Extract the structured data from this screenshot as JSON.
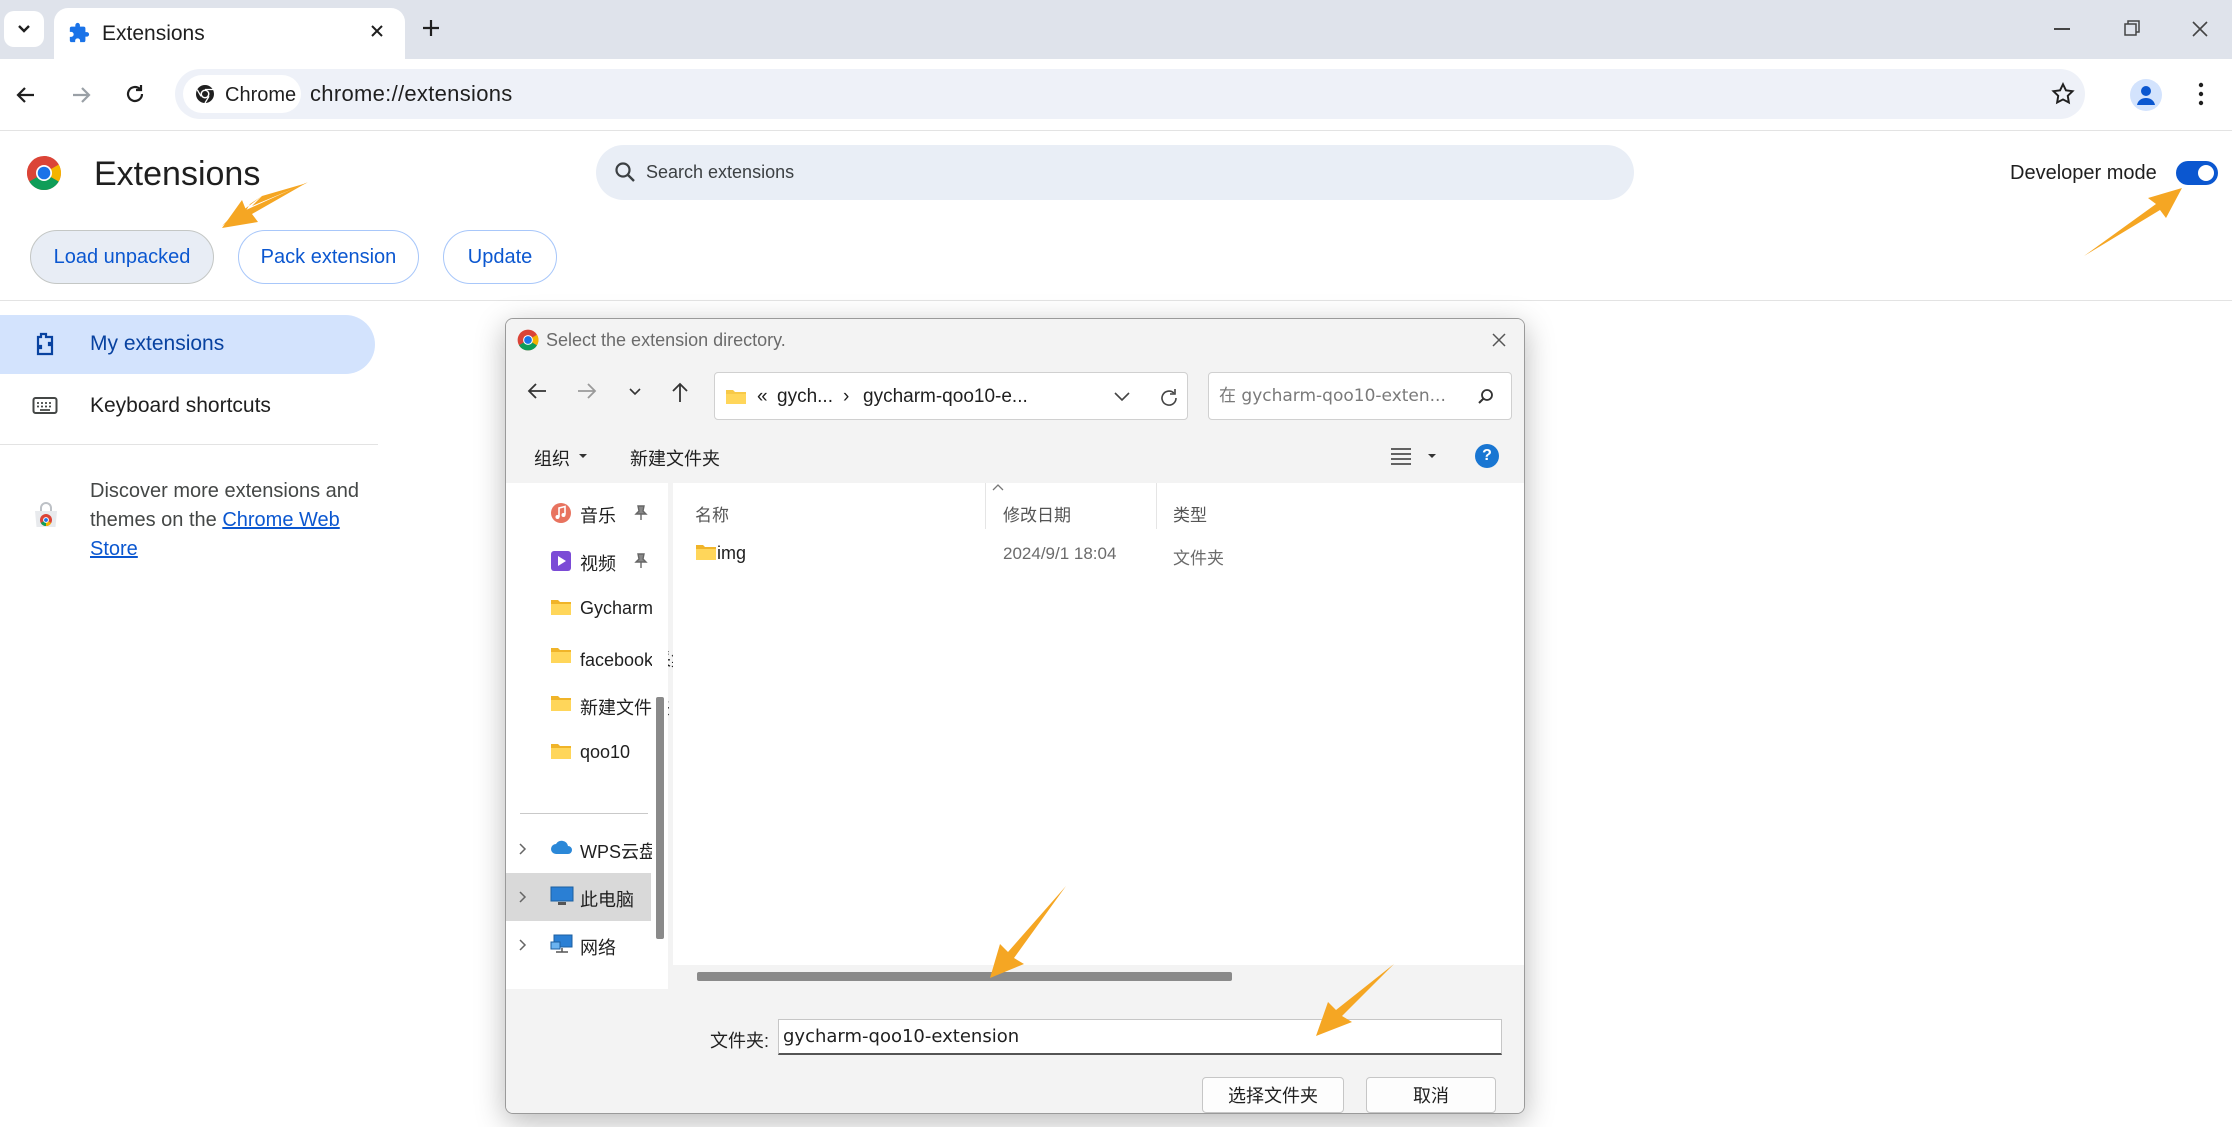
{
  "browser": {
    "tab_title": "Extensions",
    "chip_label": "Chrome",
    "url": "chrome://extensions"
  },
  "extensions_page": {
    "title": "Extensions",
    "search_placeholder": "Search extensions",
    "developer_mode_label": "Developer mode",
    "developer_mode_on": true,
    "buttons": {
      "load_unpacked": "Load unpacked",
      "pack_extension": "Pack extension",
      "update": "Update"
    },
    "sidebar": {
      "my_extensions": "My extensions",
      "keyboard_shortcuts": "Keyboard shortcuts",
      "discover_prefix": "Discover more extensions and themes on the ",
      "discover_link": "Chrome Web Store"
    }
  },
  "dialog": {
    "title": "Select the extension directory.",
    "breadcrumb": {
      "prefix": "«",
      "parent": "gych...",
      "separator": "›",
      "current": "gycharm-qoo10-e..."
    },
    "search_placeholder": "在 gycharm-qoo10-exten...",
    "commands": {
      "organize": "组织",
      "new_folder": "新建文件夹"
    },
    "nav_items": [
      {
        "label": "音乐",
        "icon": "music-icon",
        "pinned": true
      },
      {
        "label": "视频",
        "icon": "video-icon",
        "pinned": true
      },
      {
        "label": "Gycharm",
        "icon": "folder-icon",
        "pinned": false
      },
      {
        "label": "facebook采集",
        "icon": "folder-icon",
        "pinned": false
      },
      {
        "label": "新建文件夹",
        "icon": "folder-icon",
        "pinned": false
      },
      {
        "label": "qoo10",
        "icon": "folder-icon",
        "pinned": false
      }
    ],
    "nav_locations": [
      {
        "label": "WPS云盘",
        "icon": "cloud-icon",
        "selected": false
      },
      {
        "label": "此电脑",
        "icon": "computer-icon",
        "selected": true
      },
      {
        "label": "网络",
        "icon": "network-icon",
        "selected": false
      }
    ],
    "columns": {
      "name": "名称",
      "modified": "修改日期",
      "type": "类型"
    },
    "files": [
      {
        "name": "img",
        "modified": "2024/9/1 18:04",
        "type": "文件夹"
      }
    ],
    "folder_label": "文件夹:",
    "folder_value": "gycharm-qoo10-extension",
    "select_button": "选择文件夹",
    "cancel_button": "取消"
  },
  "colors": {
    "accent": "#0b57d0",
    "annotation_arrow": "#f5a623"
  }
}
